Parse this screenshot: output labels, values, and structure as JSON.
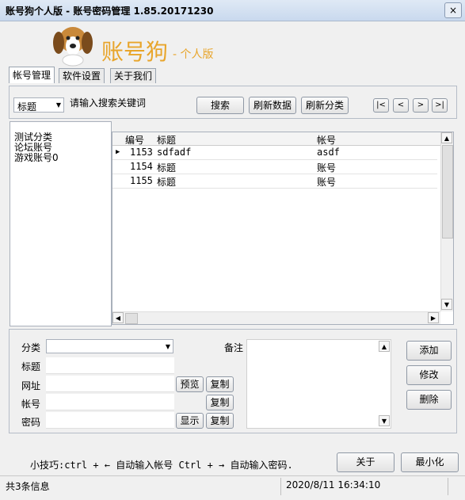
{
  "window": {
    "title": "账号狗个人版 - 账号密码管理 1.85.20171230",
    "close_label": "×"
  },
  "brand": {
    "name": "账号狗",
    "suffix": "- 个人版"
  },
  "tabs": [
    "帐号管理",
    "软件设置",
    "关于我们"
  ],
  "search": {
    "field_selected": "标题",
    "placeholder": "请输入搜索关键词",
    "search_label": "搜索",
    "refresh_data_label": "刷新数据",
    "refresh_category_label": "刷新分类"
  },
  "pager": {
    "first": "|<",
    "prev": "<",
    "next": ">",
    "last": ">|"
  },
  "categories": [
    "测试分类",
    "论坛账号",
    "游戏账号0"
  ],
  "table": {
    "headers": [
      "编号",
      "标题",
      "帐号"
    ],
    "rows": [
      {
        "id": "1153",
        "title": "sdfadf",
        "account": "asdf"
      },
      {
        "id": "1154",
        "title": "标题",
        "account": "账号"
      },
      {
        "id": "1155",
        "title": "标题",
        "account": "账号"
      }
    ]
  },
  "form": {
    "category_label": "分类",
    "title_label": "标题",
    "url_label": "网址",
    "account_label": "帐号",
    "password_label": "密码",
    "remark_label": "备注",
    "preview_label": "预览",
    "copy_label": "复制",
    "show_label": "显示",
    "add_label": "添加",
    "edit_label": "修改",
    "delete_label": "删除"
  },
  "footer": {
    "tip": "小技巧:ctrl + ← 自动输入帐号 Ctrl + → 自动输入密码.",
    "about_label": "关于",
    "minimize_label": "最小化"
  },
  "statusbar": {
    "count": "共3条信息",
    "datetime": "2020/8/11 16:34:10"
  },
  "colors": {
    "brand": "#e8a52b",
    "titlebar": "#c9d9ee"
  }
}
